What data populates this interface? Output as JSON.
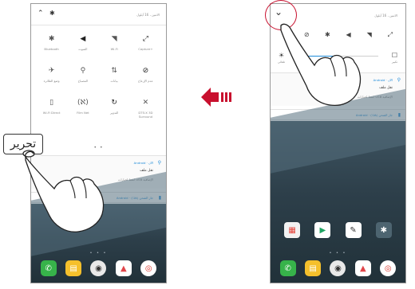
{
  "left_screen": {
    "header": {
      "date_text": "الاثنين ، 16 أيلول"
    },
    "quick_settings": [
      {
        "label": "Bluetooth",
        "icon": "bluetooth-icon",
        "glyph": "✱"
      },
      {
        "label": "الصوت",
        "icon": "volume-icon",
        "glyph": "◀"
      },
      {
        "label": "Wi-Fi",
        "icon": "wifi-off-icon",
        "glyph": "◥"
      },
      {
        "label": "Capture+",
        "icon": "capture-icon",
        "glyph": "⤢"
      },
      {
        "label": "وضع الطائرة",
        "icon": "airplane-mode-icon",
        "glyph": "✈"
      },
      {
        "label": "المصباح",
        "icon": "flashlight-icon",
        "glyph": "⚲"
      },
      {
        "label": "بيانات",
        "icon": "mobile-data-icon",
        "glyph": "⇅"
      },
      {
        "label": "عدم الإزعاج",
        "icon": "do-not-disturb-icon",
        "glyph": "⊘"
      },
      {
        "label": "Wi-Fi Direct",
        "icon": "wifi-direct-icon",
        "glyph": "▯"
      },
      {
        "label": "Film Net",
        "icon": "nfc-icon",
        "glyph": "(ℵ)"
      },
      {
        "label": "التدوير",
        "icon": "auto-rotate-icon",
        "glyph": "↻"
      },
      {
        "label": "DTS:X 3D Surround",
        "icon": "surround-sound-icon",
        "glyph": "✕"
      }
    ],
    "page_dots": "• •",
    "notification": {
      "app": "Android · الآن",
      "title": "نقل ملف",
      "text": "انقط لخيارات USB الإضافية"
    },
    "charging_text": "Android · جار الشحن (٥٨٪)"
  },
  "right_screen": {
    "header": {
      "date_text": "الاثنين ، 16 أيلول"
    },
    "quick_icons": [
      "chevron-down-icon",
      "do-not-disturb-icon",
      "bluetooth-icon",
      "volume-icon",
      "wifi-off-icon",
      "capture-icon"
    ],
    "brightness_label": "تلقائي",
    "brightness_level": 0.55,
    "square_label": "تكبير",
    "notification": {
      "app": "Android · الآن",
      "title": "نقل ملف",
      "text": "انقط لخيارات USB الإضافية"
    },
    "charging_text": "Android · جار الشحن (٥٨٪)"
  },
  "callout_text": "تحرير",
  "colors": {
    "accent": "#1d8ad8",
    "arrow": "#c8102e",
    "highlight": "#c8102e"
  }
}
